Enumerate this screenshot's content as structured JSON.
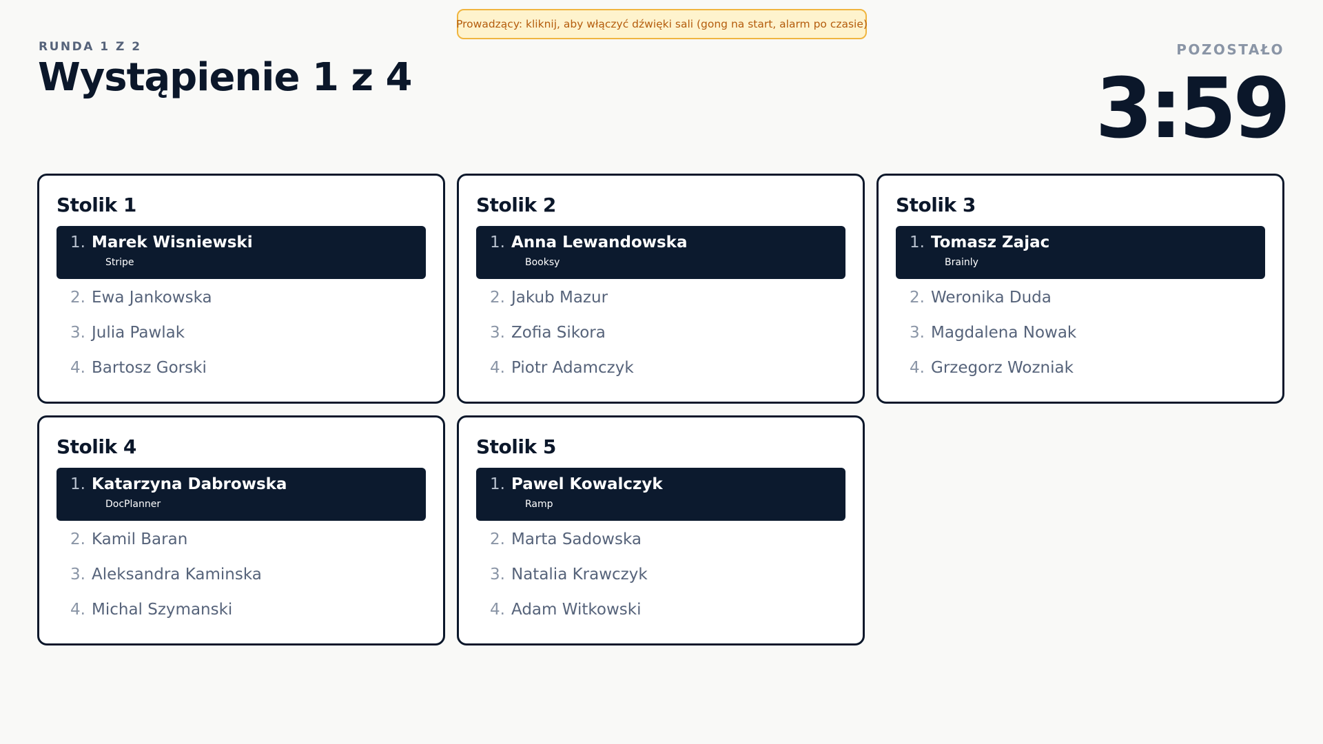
{
  "banner": "Prowadzący: kliknij, aby włączyć dźwięki sali (gong na start, alarm po czasie)",
  "round": "RUNDA 1 Z 2",
  "talk": "Wystąpienie 1 z 4",
  "timer": {
    "label": "POZOSTAŁO",
    "value": "3:59"
  },
  "tables": [
    {
      "title": "Stolik 1",
      "active": {
        "num": "1.",
        "name": "Marek Wisniewski",
        "company": "Stripe"
      },
      "speakers": [
        {
          "num": "2.",
          "name": "Ewa Jankowska"
        },
        {
          "num": "3.",
          "name": "Julia Pawlak"
        },
        {
          "num": "4.",
          "name": "Bartosz Gorski"
        }
      ]
    },
    {
      "title": "Stolik 2",
      "active": {
        "num": "1.",
        "name": "Anna Lewandowska",
        "company": "Booksy"
      },
      "speakers": [
        {
          "num": "2.",
          "name": "Jakub Mazur"
        },
        {
          "num": "3.",
          "name": "Zofia Sikora"
        },
        {
          "num": "4.",
          "name": "Piotr Adamczyk"
        }
      ]
    },
    {
      "title": "Stolik 3",
      "active": {
        "num": "1.",
        "name": "Tomasz Zajac",
        "company": "Brainly"
      },
      "speakers": [
        {
          "num": "2.",
          "name": "Weronika Duda"
        },
        {
          "num": "3.",
          "name": "Magdalena Nowak"
        },
        {
          "num": "4.",
          "name": "Grzegorz Wozniak"
        }
      ]
    },
    {
      "title": "Stolik 4",
      "active": {
        "num": "1.",
        "name": "Katarzyna Dabrowska",
        "company": "DocPlanner"
      },
      "speakers": [
        {
          "num": "2.",
          "name": "Kamil Baran"
        },
        {
          "num": "3.",
          "name": "Aleksandra Kaminska"
        },
        {
          "num": "4.",
          "name": "Michal Szymanski"
        }
      ]
    },
    {
      "title": "Stolik 5",
      "active": {
        "num": "1.",
        "name": "Pawel Kowalczyk",
        "company": "Ramp"
      },
      "speakers": [
        {
          "num": "2.",
          "name": "Marta Sadowska"
        },
        {
          "num": "3.",
          "name": "Natalia Krawczyk"
        },
        {
          "num": "4.",
          "name": "Adam Witkowski"
        }
      ]
    }
  ]
}
